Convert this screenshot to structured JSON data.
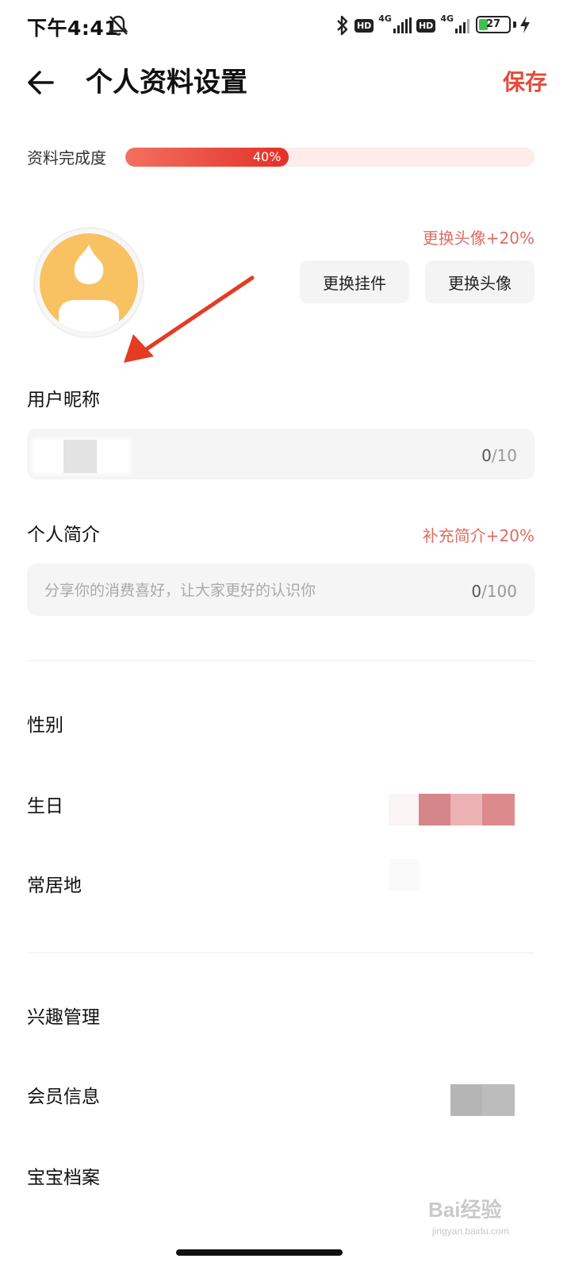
{
  "status_bar": {
    "time": "下午4:41",
    "network_1": "4G",
    "network_2": "4G",
    "hd_label": "HD",
    "battery": "27"
  },
  "header": {
    "title": "个人资料设置",
    "save_label": "保存"
  },
  "completion": {
    "label": "资料完成度",
    "percent_text": "40%",
    "value": 0.4
  },
  "avatar_section": {
    "bonus": "更换头像+20%",
    "change_pendant": "更换挂件",
    "change_avatar": "更换头像"
  },
  "nickname": {
    "label": "用户昵称",
    "count": "0",
    "limit": "/10"
  },
  "bio": {
    "label": "个人简介",
    "bonus": "补充简介+20%",
    "placeholder": "分享你的消费喜好，让大家更好的认识你",
    "count": "0",
    "limit": "/100"
  },
  "rows": {
    "gender": "性别",
    "birthday": "生日",
    "residence": "常居地",
    "interests": "兴趣管理",
    "membership": "会员信息",
    "baby": "宝宝档案"
  },
  "watermark": {
    "text": "Bai经验",
    "sub": "jingyan.baidu.com"
  },
  "colors": {
    "accent": "#e54b3a",
    "bonus": "#e06c63",
    "avatar": "#f8c262"
  }
}
